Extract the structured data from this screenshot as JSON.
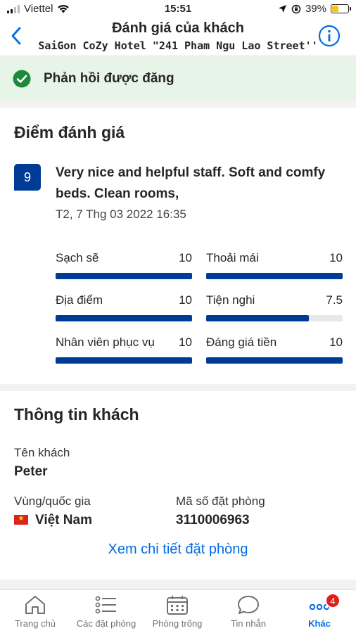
{
  "status_bar": {
    "carrier": "Viettel",
    "time": "15:51",
    "battery": "39%"
  },
  "header": {
    "title": "Đánh giá của khách",
    "subtitle": "SaiGon CoZy Hotel \"241 Pham Ngu Lao Street''",
    "back_icon": "chevron-left-icon",
    "info_icon": "info-circle-icon"
  },
  "banner": {
    "text": "Phản hồi được đăng",
    "icon": "check-circle-icon",
    "color": "#1b8a3a"
  },
  "score_section": {
    "title": "Điểm đánh giá",
    "score": "9",
    "review": "Very nice and helpful staff. Soft and comfy beds. Clean rooms,",
    "date": "T2, 7 Thg 03 2022 16:35",
    "categories": [
      {
        "label": "Sạch sẽ",
        "value": "10",
        "level": 1.0
      },
      {
        "label": "Thoải mái",
        "value": "10",
        "level": 1.0
      },
      {
        "label": "Địa điểm",
        "value": "10",
        "level": 1.0
      },
      {
        "label": "Tiện nghi",
        "value": "7.5",
        "level": 0.75
      },
      {
        "label": "Nhân viên phục vụ",
        "value": "10",
        "level": 1.0
      },
      {
        "label": "Đáng giá tiền",
        "value": "10",
        "level": 1.0
      }
    ]
  },
  "guest_section": {
    "title": "Thông tin khách",
    "name_label": "Tên khách",
    "name": "Peter",
    "country_label": "Vùng/quốc gia",
    "country": "Việt Nam",
    "booking_label": "Mã số đặt phòng",
    "booking_number": "3110006963",
    "link": "Xem chi tiết đặt phòng"
  },
  "tabs": [
    {
      "label": "Trang chủ",
      "icon": "home-icon"
    },
    {
      "label": "Các đặt phòng",
      "icon": "list-icon"
    },
    {
      "label": "Phòng trống",
      "icon": "calendar-icon"
    },
    {
      "label": "Tin nhắn",
      "icon": "chat-bubble-icon"
    },
    {
      "label": "Khác",
      "icon": "more-icon",
      "badge": "4",
      "active": true
    }
  ],
  "colors": {
    "brand_blue": "#003b95",
    "link_blue": "#006ce4",
    "success_bg": "#e7f4e8",
    "badge_red": "#e0201b"
  }
}
